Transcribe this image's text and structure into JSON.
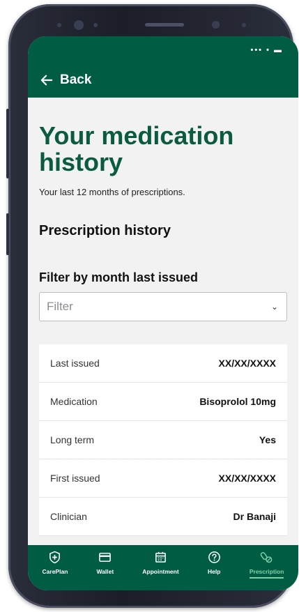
{
  "header": {
    "back_label": "Back",
    "signal_icons": "••• • ▬"
  },
  "page": {
    "title": "Your medication history",
    "subtitle": "Your last 12 months of prescriptions.",
    "section_title": "Prescription history"
  },
  "filter": {
    "label": "Filter by month last issued",
    "selected": "Filter"
  },
  "details": [
    {
      "key": "Last issued",
      "value": "XX/XX/XXXX"
    },
    {
      "key": "Medication",
      "value": "Bisoprolol 10mg"
    },
    {
      "key": "Long term",
      "value": "Yes"
    },
    {
      "key": "First issued",
      "value": "XX/XX/XXXX"
    },
    {
      "key": "Clinician",
      "value": "Dr Banaji"
    }
  ],
  "nav": [
    {
      "label": "CarePlan",
      "icon": "shield-plus-icon"
    },
    {
      "label": "Wallet",
      "icon": "card-icon"
    },
    {
      "label": "Appointment",
      "icon": "calendar-icon"
    },
    {
      "label": "Help",
      "icon": "help-icon"
    },
    {
      "label": "Prescription",
      "icon": "pills-icon",
      "active": true
    }
  ],
  "colors": {
    "brand": "#005c42",
    "title": "#0b5a42",
    "active_tab": "#7fd1a8"
  }
}
